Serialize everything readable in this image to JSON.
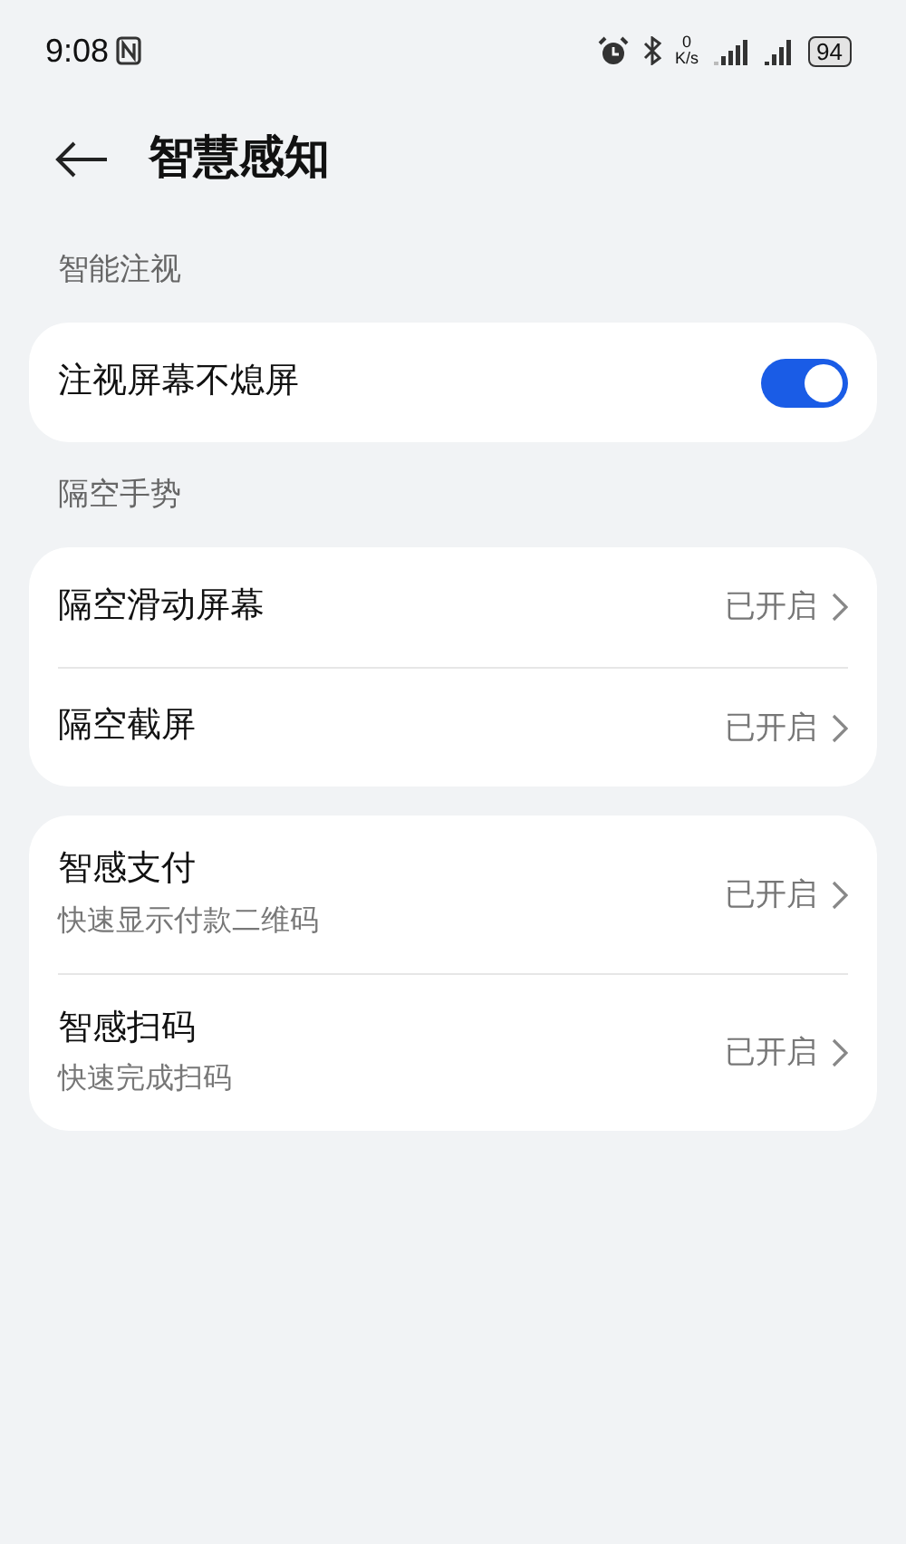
{
  "status_bar": {
    "time": "9:08",
    "net_speed_value": "0",
    "net_speed_unit": "K/s",
    "battery": "94"
  },
  "header": {
    "title": "智慧感知"
  },
  "groups": [
    {
      "title": "智能注视",
      "items": [
        {
          "kind": "toggle",
          "label": "注视屏幕不熄屏",
          "on": true
        }
      ]
    },
    {
      "title": "隔空手势",
      "items": [
        {
          "kind": "link",
          "label": "隔空滑动屏幕",
          "value": "已开启"
        },
        {
          "kind": "link",
          "label": "隔空截屏",
          "value": "已开启"
        }
      ]
    },
    {
      "items": [
        {
          "kind": "link",
          "label": "智感支付",
          "subtitle": "快速显示付款二维码",
          "value": "已开启"
        },
        {
          "kind": "link",
          "label": "智感扫码",
          "subtitle": "快速完成扫码",
          "value": "已开启"
        }
      ]
    }
  ]
}
